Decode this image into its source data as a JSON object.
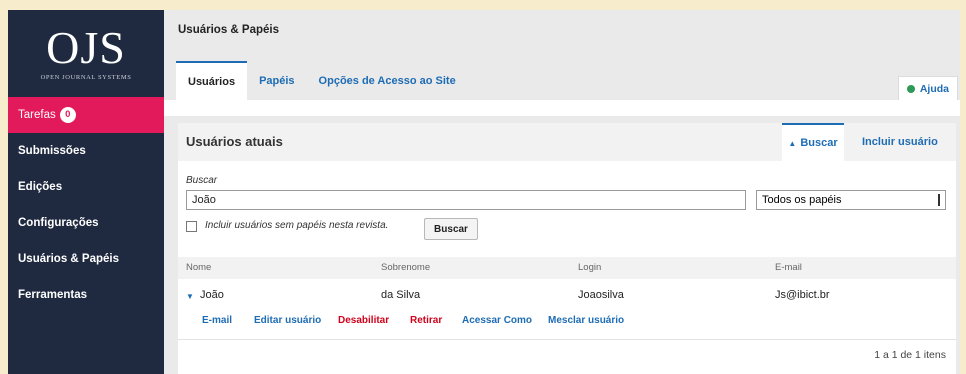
{
  "app": {
    "logo_text": "OJS",
    "logo_subtitle": "OPEN JOURNAL SYSTEMS"
  },
  "sidebar": {
    "items": [
      {
        "label": "Tarefas",
        "badge": "0",
        "active": true
      },
      {
        "label": "Submissões"
      },
      {
        "label": "Edições"
      },
      {
        "label": "Configurações"
      },
      {
        "label": "Usuários & Papéis"
      },
      {
        "label": "Ferramentas"
      }
    ]
  },
  "page": {
    "title": "Usuários & Papéis"
  },
  "tabs": [
    {
      "label": "Usuários",
      "active": true
    },
    {
      "label": "Papéis"
    },
    {
      "label": "Opções de Acesso ao Site"
    }
  ],
  "help": {
    "label": "Ajuda",
    "icon": "help-circle-icon"
  },
  "panel": {
    "title": "Usuários atuais",
    "actions": {
      "search": "Buscar",
      "add_user": "Incluir usuário"
    },
    "search": {
      "label": "Buscar",
      "value": "João",
      "role_select": "Todos os papéis",
      "checkbox_label": "Incluir usuários sem papéis nesta revista.",
      "button": "Buscar"
    },
    "columns": [
      "Nome",
      "Sobrenome",
      "Login",
      "E-mail"
    ],
    "rows": [
      {
        "nome": "João",
        "sobrenome": "da Silva",
        "login": "Joaosilva",
        "email": "Js@ibict.br"
      }
    ],
    "row_actions": [
      "E-mail",
      "Editar usuário",
      "Desabilitar",
      "Retirar",
      "Acessar Como",
      "Mesclar usuário"
    ],
    "pager": "1 a 1 de 1 itens"
  },
  "colors": {
    "sidebar": "#1f2a40",
    "accent": "#e2195a",
    "link": "#1e6cb4",
    "danger": "#d0021b"
  }
}
